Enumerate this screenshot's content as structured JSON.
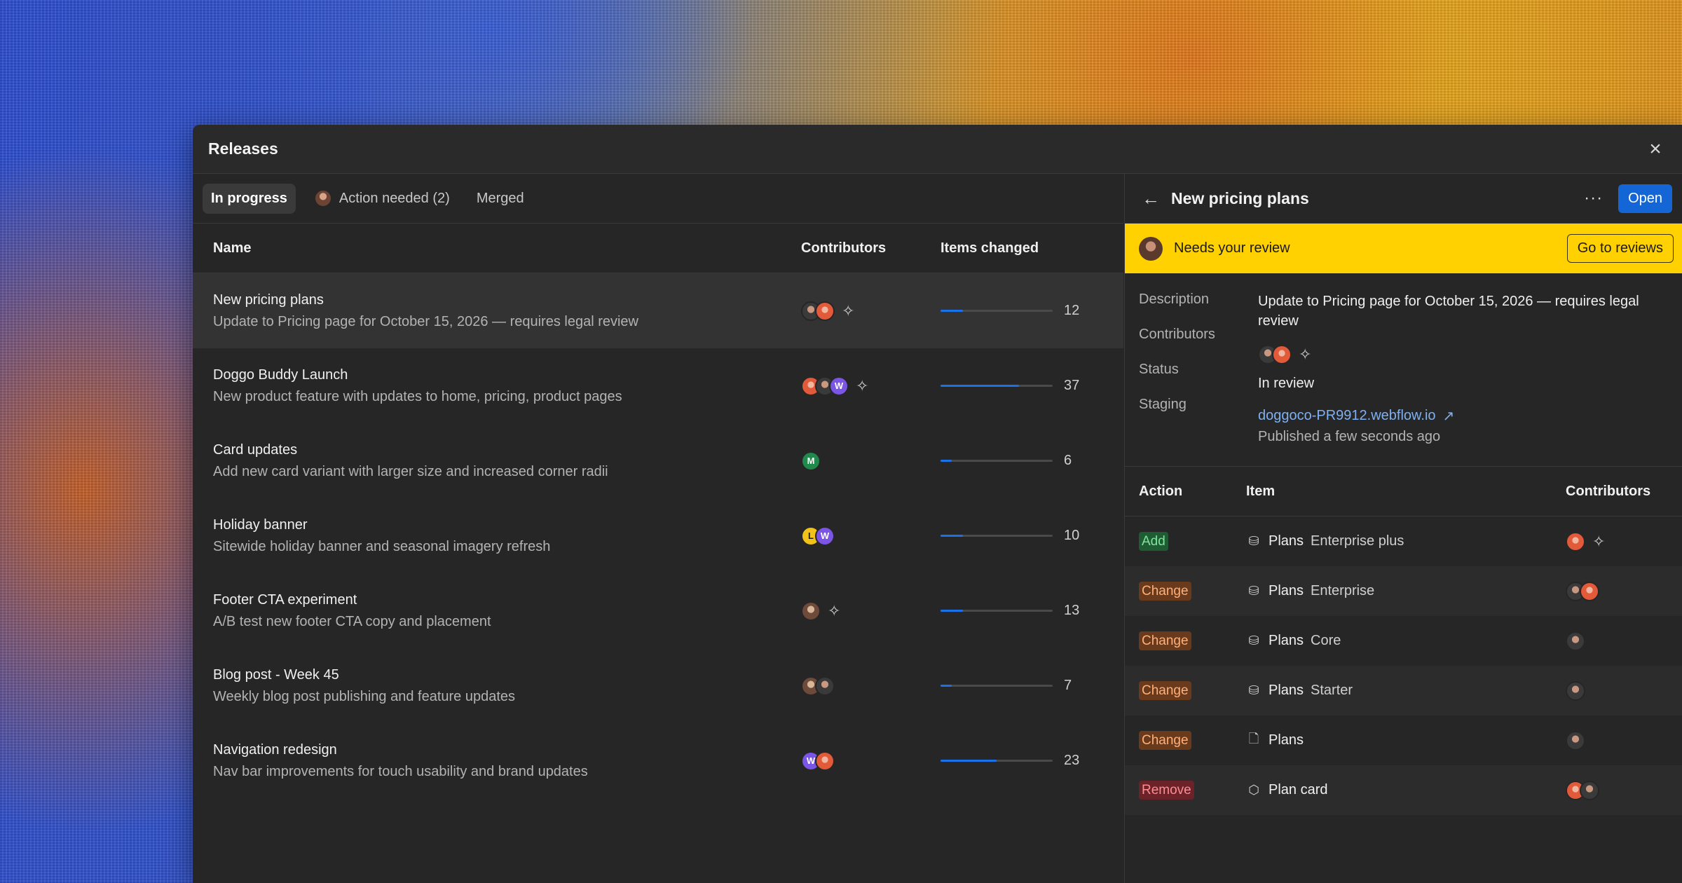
{
  "window": {
    "title": "Releases"
  },
  "tabs": [
    {
      "label": "In progress",
      "active": true
    },
    {
      "label": "Action needed (2)",
      "active": false
    },
    {
      "label": "Merged",
      "active": false
    }
  ],
  "table": {
    "headers": {
      "name": "Name",
      "contributors": "Contributors",
      "items_changed": "Items changed"
    },
    "rows": [
      {
        "title": "New pricing plans",
        "subtitle": "Update to Pricing page for October 15, 2026 — requires legal review",
        "count": "12",
        "progress": 0.2
      },
      {
        "title": "Doggo Buddy Launch",
        "subtitle": "New product feature with updates to home, pricing, product pages",
        "count": "37",
        "progress": 0.7
      },
      {
        "title": "Card updates",
        "subtitle": "Add new card variant with larger size and increased corner radii",
        "count": "6",
        "progress": 0.1
      },
      {
        "title": "Holiday banner",
        "subtitle": "Sitewide holiday banner and seasonal imagery refresh",
        "count": "10",
        "progress": 0.2
      },
      {
        "title": "Footer CTA experiment",
        "subtitle": "A/B test new footer CTA copy and placement",
        "count": "13",
        "progress": 0.2
      },
      {
        "title": "Blog post - Week 45",
        "subtitle": "Weekly blog post publishing and feature updates",
        "count": "7",
        "progress": 0.1
      },
      {
        "title": "Navigation redesign",
        "subtitle": "Nav bar improvements for touch usability and brand updates",
        "count": "23",
        "progress": 0.5
      }
    ]
  },
  "avatar_letters": {
    "w": "W",
    "m": "M",
    "l": "L"
  },
  "detail": {
    "title": "New pricing plans",
    "open_label": "Open",
    "more_label": "···",
    "banner": {
      "text": "Needs your review",
      "button": "Go to reviews",
      "color": "#ffd100"
    },
    "labels": {
      "description": "Description",
      "contributors": "Contributors",
      "status": "Status",
      "staging": "Staging"
    },
    "description": "Update to Pricing page for October 15, 2026 — requires legal review",
    "status": "In review",
    "staging_link": "doggoco-PR9912.webflow.io",
    "published": "Published a few seconds ago"
  },
  "actions": {
    "headers": {
      "action": "Action",
      "item": "Item",
      "contributors": "Contributors"
    },
    "rows": [
      {
        "action": "Add",
        "type": "add",
        "icon": "database-icon",
        "main": "Plans",
        "secondary": "Enterprise plus"
      },
      {
        "action": "Change",
        "type": "change",
        "icon": "database-icon",
        "main": "Plans",
        "secondary": "Enterprise"
      },
      {
        "action": "Change",
        "type": "change",
        "icon": "database-icon",
        "main": "Plans",
        "secondary": "Core"
      },
      {
        "action": "Change",
        "type": "change",
        "icon": "database-icon",
        "main": "Plans",
        "secondary": "Starter"
      },
      {
        "action": "Change",
        "type": "change",
        "icon": "page-icon",
        "main": "Plans",
        "secondary": ""
      },
      {
        "action": "Remove",
        "type": "remove",
        "icon": "component-icon",
        "main": "Plan card",
        "secondary": ""
      }
    ]
  },
  "colors": {
    "accent": "#1466d6",
    "add": "#7fe39d",
    "change": "#ffb07a",
    "remove": "#ff8c94"
  }
}
